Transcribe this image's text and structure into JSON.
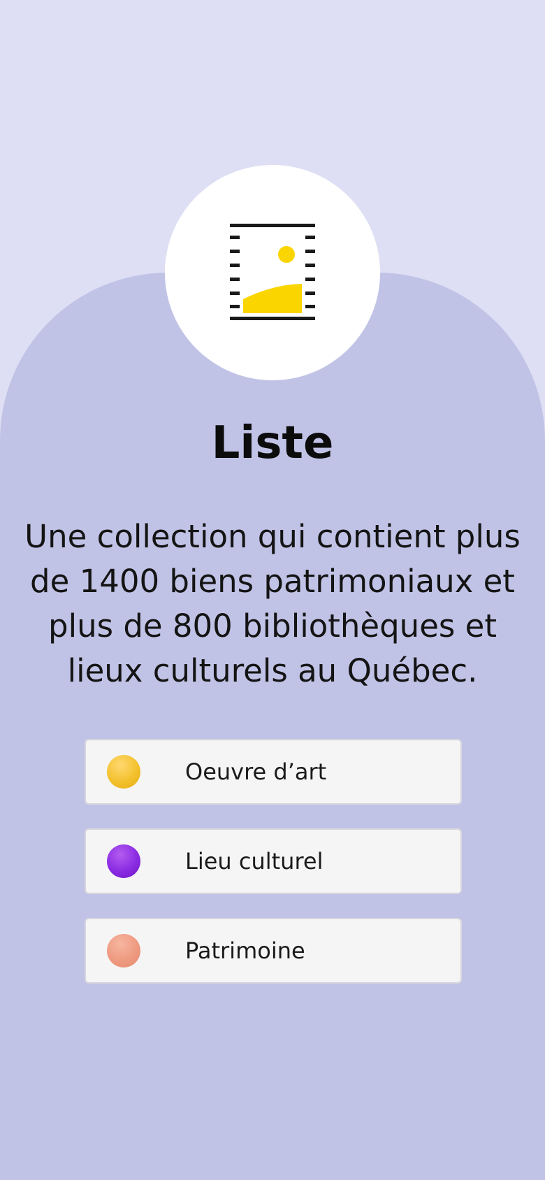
{
  "colors": {
    "background_top": "#dedff4",
    "background_panel": "#c1c3e6",
    "icon_accent": "#fbd500"
  },
  "header": {
    "icon": "collection-list-icon",
    "title": "Liste"
  },
  "main": {
    "description": "Une collection qui contient plus de 1400 biens patrimoniaux et plus de 800 bibliothèques et lieux culturels au Québec."
  },
  "filters": [
    {
      "label": "Oeuvre d’art",
      "icon": "yellow-dot-icon",
      "color": "#f3c12e"
    },
    {
      "label": "Lieu culturel",
      "icon": "purple-dot-icon",
      "color": "#8a2be2"
    },
    {
      "label": "Patrimoine",
      "icon": "salmon-dot-icon",
      "color": "#ee9a80"
    }
  ]
}
